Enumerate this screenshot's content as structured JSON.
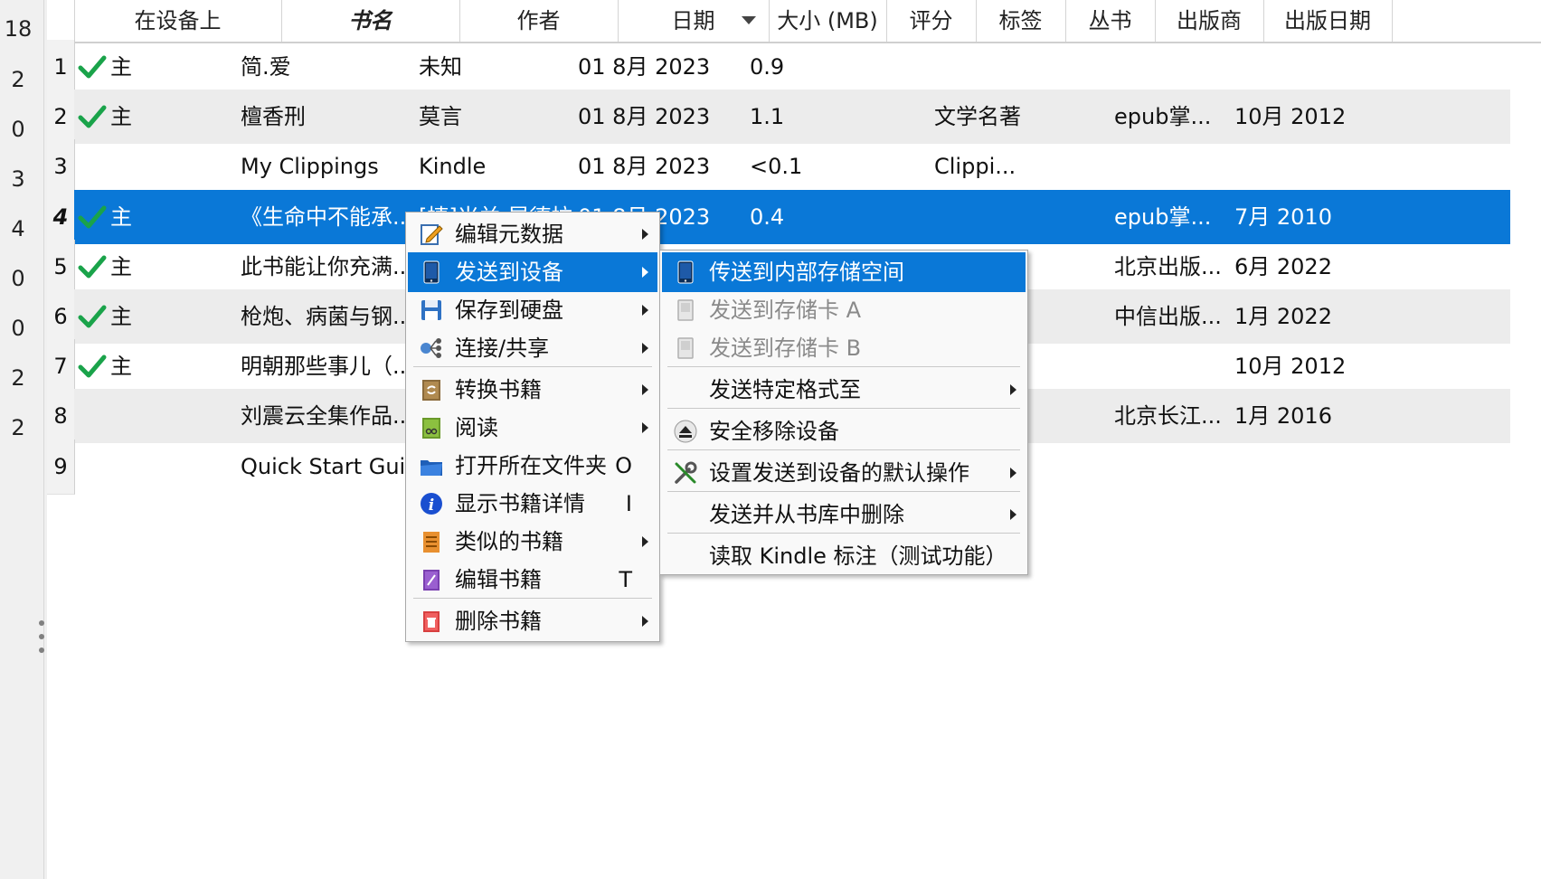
{
  "left_strip": {
    "numbers": [
      "18",
      "2",
      "0",
      "3",
      "4",
      "0",
      "0",
      "2",
      "2"
    ]
  },
  "columns": [
    "在设备上",
    "书名",
    "作者",
    "日期",
    "大小 (MB)",
    "评分",
    "标签",
    "丛书",
    "出版商",
    "出版日期"
  ],
  "rows": [
    {
      "num": "1",
      "device": "主",
      "checked": true,
      "title": "简.爱",
      "author": "未知",
      "date": "01 8月 2023",
      "size": "0.9",
      "tags": "",
      "publisher": "",
      "pubdate": ""
    },
    {
      "num": "2",
      "device": "主",
      "checked": true,
      "title": "檀香刑",
      "author": "莫言",
      "date": "01 8月 2023",
      "size": "1.1",
      "tags": "文学名著",
      "publisher": "epub掌...",
      "pubdate": "10月 2012"
    },
    {
      "num": "3",
      "device": "",
      "checked": false,
      "title": "My Clippings",
      "author": "Kindle",
      "date": "01 8月 2023",
      "size": "<0.1",
      "tags": "Clippi...",
      "publisher": "",
      "pubdate": ""
    },
    {
      "num": "4",
      "device": "主",
      "checked": true,
      "title": "《生命中不能承...",
      "author": "[捷]米兰·昆德拉",
      "date": "01 8月 2023",
      "size": "0.4",
      "tags": "",
      "publisher": "epub掌...",
      "pubdate": "7月 2010"
    },
    {
      "num": "5",
      "device": "主",
      "checked": true,
      "title": "此书能让你充满...",
      "author": "",
      "date": "",
      "size": "",
      "tags": "",
      "publisher": "北京出版...",
      "pubdate": "6月 2022"
    },
    {
      "num": "6",
      "device": "主",
      "checked": true,
      "title": "枪炮、病菌与钢...",
      "author": "",
      "date": "",
      "size": "",
      "tags": "",
      "publisher": "中信出版...",
      "pubdate": "1月 2022"
    },
    {
      "num": "7",
      "device": "主",
      "checked": true,
      "title": "明朝那些事儿（...",
      "author": "",
      "date": "",
      "size": "",
      "tags": "",
      "publisher": "",
      "pubdate": "10月 2012"
    },
    {
      "num": "8",
      "device": "",
      "checked": false,
      "title": "刘震云全集作品...",
      "author": "",
      "date": "",
      "size": "",
      "tags": "",
      "publisher": "北京长江...",
      "pubdate": "1月 2016"
    },
    {
      "num": "9",
      "device": "",
      "checked": false,
      "title": "Quick Start Guide",
      "author": "",
      "date": "",
      "size": "",
      "tags": "",
      "publisher": "",
      "pubdate": ""
    }
  ],
  "context_menu": {
    "items": [
      {
        "label": "编辑元数据",
        "key": "",
        "submenu": true,
        "icon": "edit-metadata-icon"
      },
      {
        "label": "发送到设备",
        "key": "",
        "submenu": true,
        "icon": "device-icon"
      },
      {
        "label": "保存到硬盘",
        "key": "",
        "submenu": true,
        "icon": "save-disk-icon"
      },
      {
        "label": "连接/共享",
        "key": "",
        "submenu": true,
        "icon": "connect-share-icon"
      },
      {
        "label": "转换书籍",
        "key": "",
        "submenu": true,
        "icon": "convert-icon"
      },
      {
        "label": "阅读",
        "key": "",
        "submenu": true,
        "icon": "read-icon"
      },
      {
        "label": "打开所在文件夹",
        "key": "O",
        "submenu": false,
        "icon": "folder-icon"
      },
      {
        "label": "显示书籍详情",
        "key": "I",
        "submenu": false,
        "icon": "info-icon"
      },
      {
        "label": "类似的书籍",
        "key": "",
        "submenu": true,
        "icon": "similar-books-icon"
      },
      {
        "label": "编辑书籍",
        "key": "T",
        "submenu": false,
        "icon": "edit-book-icon"
      },
      {
        "label": "删除书籍",
        "key": "",
        "submenu": true,
        "icon": "trash-icon"
      }
    ]
  },
  "submenu": {
    "items": [
      {
        "label": "传送到内部存储空间",
        "icon": "device-icon"
      },
      {
        "label": "发送到存储卡 A",
        "icon": "card-icon"
      },
      {
        "label": "发送到存储卡 B",
        "icon": "card-icon"
      },
      {
        "label": "发送特定格式至",
        "icon": ""
      },
      {
        "label": "安全移除设备",
        "icon": "eject-icon"
      },
      {
        "label": "设置发送到设备的默认操作",
        "icon": "tools-icon"
      },
      {
        "label": "发送并从书库中删除",
        "icon": ""
      },
      {
        "label": "读取 Kindle 标注（测试功能）",
        "icon": ""
      }
    ]
  },
  "colors": {
    "selection": "#0a78d7",
    "check": "#1aa34a"
  }
}
